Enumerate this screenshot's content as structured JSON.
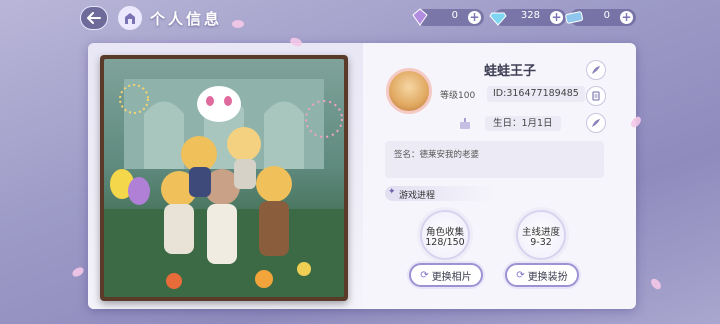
{
  "header": {
    "title": "个人信息"
  },
  "currencies": [
    {
      "name": "gem-icon",
      "value": "0",
      "color": "#b38de0"
    },
    {
      "name": "diamond-icon",
      "value": "328",
      "color": "#7fd6f2"
    },
    {
      "name": "ticket-icon",
      "value": "0",
      "color": "#8fc6ee"
    }
  ],
  "profile": {
    "nickname": "蛙蛙王子",
    "level": "等级100",
    "uid": "ID:316477189485",
    "birthday": "生日：1月1日",
    "signature": "签名：德莱安我的老婆"
  },
  "progress": {
    "header": "游戏进程",
    "collection_label": "角色收集",
    "collection_value": "128/150",
    "story_label": "主线进度",
    "story_value": "9-32"
  },
  "buttons": {
    "change_photo": "更换相片",
    "change_outfit": "更换装扮"
  },
  "colors": {
    "accent": "#9c93d4",
    "frame": "#5a3b2a"
  }
}
